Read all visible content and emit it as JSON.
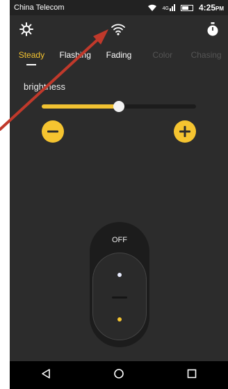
{
  "status_bar": {
    "carrier": "China Telecom",
    "network": "4G",
    "time": "4:25",
    "time_suffix": "PM"
  },
  "toolbar": {
    "left_icon": "settings-sun-icon",
    "center_icon": "wifi-icon",
    "right_icon": "timer-icon"
  },
  "tabs": [
    {
      "label": "Steady",
      "state": "active"
    },
    {
      "label": "Flashing",
      "state": "normal"
    },
    {
      "label": "Fading",
      "state": "normal"
    },
    {
      "label": "Color",
      "state": "disabled"
    },
    {
      "label": "Chasing",
      "state": "disabled"
    }
  ],
  "brightness": {
    "label": "brightness",
    "value_fraction": 0.5,
    "decrease_icon": "minus-icon",
    "increase_icon": "plus-icon"
  },
  "power_switch": {
    "label": "OFF"
  },
  "nav_bar": {
    "back_icon": "back-triangle-icon",
    "home_icon": "home-circle-icon",
    "recents_icon": "recents-square-icon"
  },
  "colors": {
    "accent": "#f5c430",
    "background": "#2c2c2c",
    "annotation_arrow": "#c0392b"
  }
}
